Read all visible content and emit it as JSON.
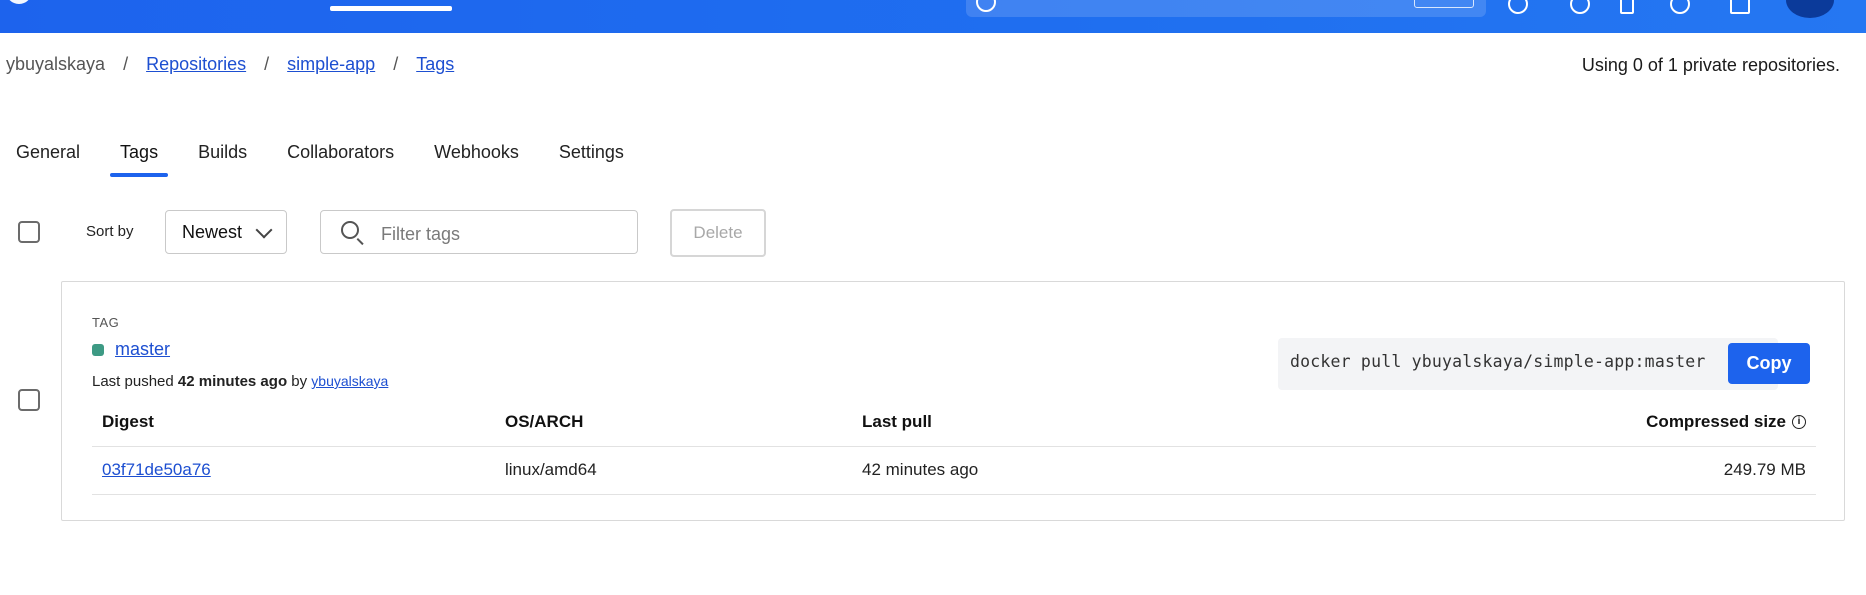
{
  "breadcrumb": {
    "user": "ybuyalskaya",
    "separator": "/",
    "repositories": "Repositories",
    "repo": "simple-app",
    "current": "Tags"
  },
  "usage_text": "Using 0 of 1 private repositories.",
  "tabs": [
    {
      "label": "General",
      "active": false
    },
    {
      "label": "Tags",
      "active": true
    },
    {
      "label": "Builds",
      "active": false
    },
    {
      "label": "Collaborators",
      "active": false
    },
    {
      "label": "Webhooks",
      "active": false
    },
    {
      "label": "Settings",
      "active": false
    }
  ],
  "toolbar": {
    "sort_label": "Sort by",
    "sort_value": "Newest",
    "filter_placeholder": "Filter tags",
    "delete_label": "Delete"
  },
  "tag_card": {
    "caption": "TAG",
    "tag_name": "master",
    "status_color": "#3d9a84",
    "pushed_prefix": "Last pushed",
    "pushed_time": "42 minutes ago",
    "pushed_by_prefix": "by",
    "pushed_by": "ybuyalskaya",
    "pull_command": "docker pull ybuyalskaya/simple-app:master",
    "copy_label": "Copy",
    "table": {
      "headers": [
        "Digest",
        "OS/ARCH",
        "Last pull",
        "Compressed size"
      ],
      "rows": [
        {
          "digest": "03f71de50a76",
          "os_arch": "linux/amd64",
          "last_pull": "42 minutes ago",
          "size": "249.79 MB"
        }
      ]
    }
  },
  "colors": {
    "accent": "#1d63ed",
    "link": "#1d4fd1"
  }
}
